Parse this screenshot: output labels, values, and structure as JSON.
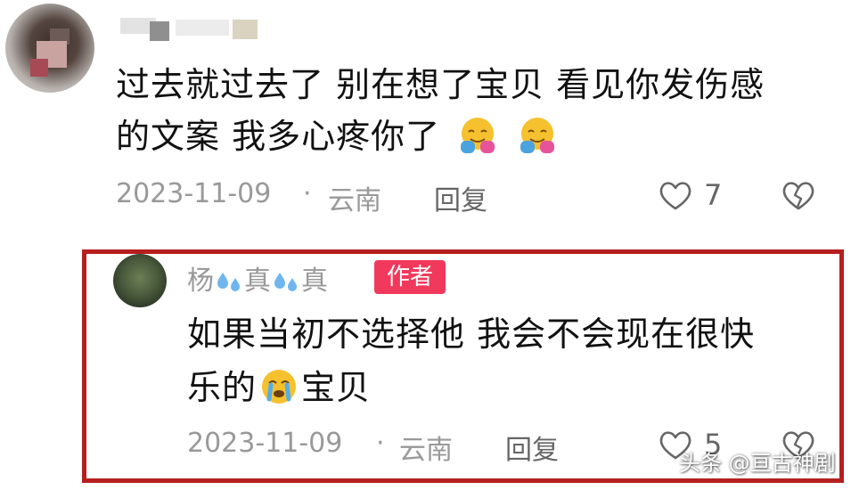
{
  "comment": {
    "text_line1": "过去就过去了 别在想了宝贝 看见你发伤感",
    "text_line2": "的文案 我多心疼你了",
    "emojis": [
      "hug-emoji",
      "hug-emoji"
    ],
    "date": "2023-11-09",
    "separator": "·",
    "location": "云南",
    "reply_label": "回复",
    "likes": "7"
  },
  "reply": {
    "name_part1": "杨",
    "name_part2": "真",
    "name_part3": "真",
    "badge": "作者",
    "text_line1": "如果当初不选择他 我会不会现在很快",
    "text_line2_prefix": "乐的",
    "text_line2_suffix": "宝贝",
    "emoji": "crying-emoji",
    "date": "2023-11-09",
    "separator": "·",
    "location": "云南",
    "reply_label": "回复",
    "likes": "5"
  },
  "watermark": "头条 @亘古神剧",
  "colors": {
    "highlight_border": "#b61f1f",
    "author_badge": "#f1395c",
    "meta_text": "#999999"
  }
}
